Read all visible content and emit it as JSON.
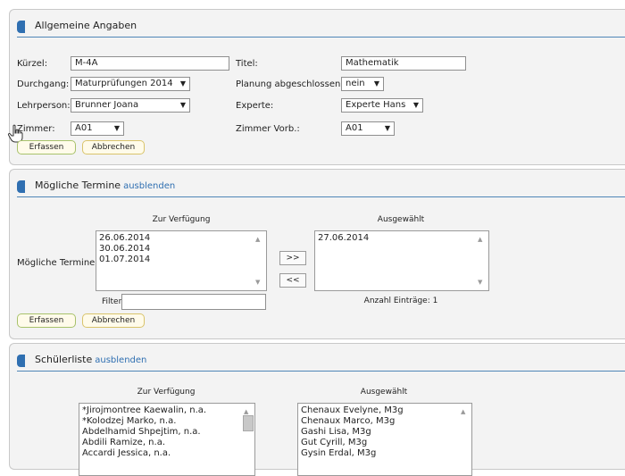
{
  "general": {
    "title": "Allgemeine Angaben",
    "fields": {
      "kuerzel_label": "Kürzel:",
      "kuerzel_value": "M-4A",
      "titel_label": "Titel:",
      "titel_value": "Mathematik",
      "durchgang_label": "Durchgang:",
      "durchgang_value": "Maturprüfungen 2014",
      "planung_label": "Planung abgeschlossen:",
      "planung_value": "nein",
      "lehrperson_label": "Lehrperson:",
      "lehrperson_value": "Brunner Joana",
      "experte_label": "Experte:",
      "experte_value": "Experte Hans",
      "zimmer_label": "Zimmer:",
      "zimmer_value": "A01",
      "zimmer_vorb_label": "Zimmer Vorb.:",
      "zimmer_vorb_value": "A01"
    },
    "save_label": "Erfassen",
    "cancel_label": "Abbrechen"
  },
  "termine": {
    "title": "Mögliche Termine",
    "toggle_link": "ausblenden",
    "available_header": "Zur Verfügung",
    "selected_header": "Ausgewählt",
    "row_label": "Mögliche Termine:",
    "available": [
      "26.06.2014",
      "30.06.2014",
      "01.07.2014"
    ],
    "selected": [
      "27.06.2014"
    ],
    "add_label": ">>",
    "remove_label": "<<",
    "filter_label": "Filter:",
    "filter_value": "",
    "count_text": "Anzahl Einträge: 1",
    "save_label": "Erfassen",
    "cancel_label": "Abbrechen"
  },
  "schueler": {
    "title": "Schülerliste",
    "toggle_link": "ausblenden",
    "available_header": "Zur Verfügung",
    "selected_header": "Ausgewählt",
    "available": [
      "*Jirojmontree Kaewalin, n.a.",
      "*Kolodzej Marko, n.a.",
      "Abdelhamid Shpejtim, n.a.",
      "Abdili Ramize, n.a.",
      "Accardi Jessica, n.a."
    ],
    "selected": [
      "Chenaux Evelyne, M3g",
      "Chenaux Marco, M3g",
      "Gashi Lisa, M3g",
      "Gut Cyrill, M3g",
      "Gysin Erdal, M3g"
    ]
  },
  "icons": {
    "cursor": "hand-cursor-icon",
    "dropdown": "chevron-down-icon"
  }
}
